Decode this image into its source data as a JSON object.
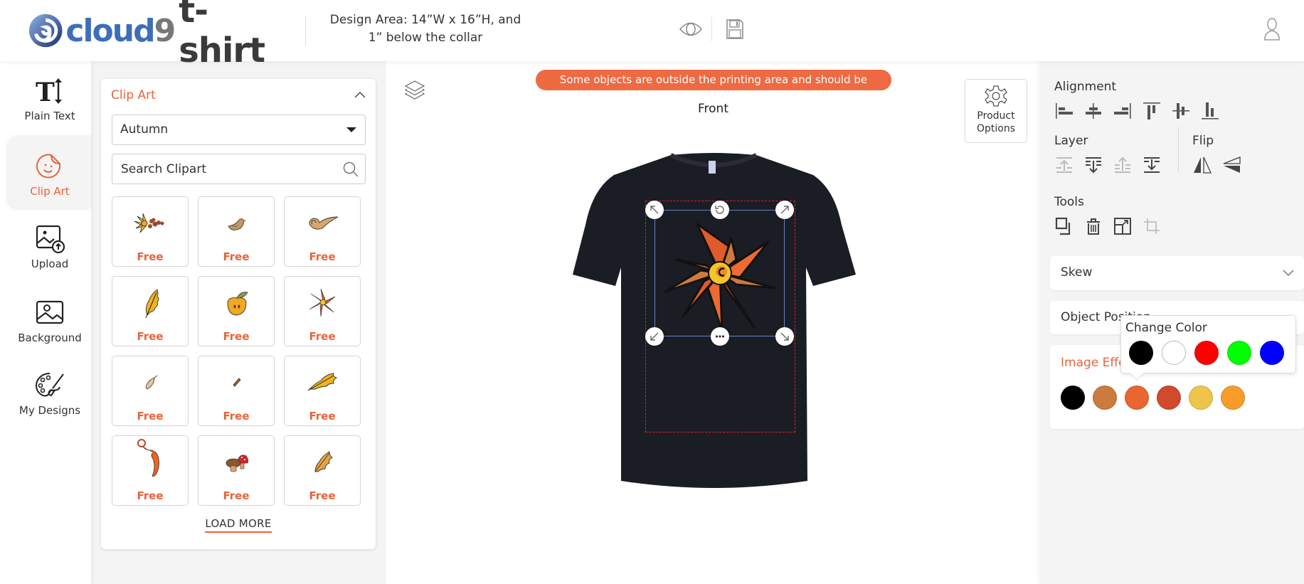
{
  "header": {
    "logo_text_part1": "cloud",
    "logo_text_part2": "9",
    "logo_text_part3": "t-shirt",
    "design_area_line1": "Design Area: 14”W x 16”H, and",
    "design_area_line2": "1” below the collar",
    "icons": [
      "eye-icon",
      "save-icon",
      "user-icon"
    ]
  },
  "left_nav": {
    "items": [
      {
        "label": "Plain Text",
        "icon": "text-icon",
        "active": false
      },
      {
        "label": "Clip Art",
        "icon": "sticker-icon",
        "active": true
      },
      {
        "label": "Upload",
        "icon": "upload-image-icon",
        "active": false
      },
      {
        "label": "Background",
        "icon": "image-icon",
        "active": false
      },
      {
        "label": "My Designs",
        "icon": "palette-icon",
        "active": false
      }
    ]
  },
  "clip_panel": {
    "title": "Clip Art",
    "category_selected": "Autumn",
    "search_placeholder": "Search Clipart",
    "tiles": [
      {
        "name": "sunflower-berries",
        "price": "Free"
      },
      {
        "name": "bird",
        "price": "Free"
      },
      {
        "name": "swirl-wind",
        "price": "Free"
      },
      {
        "name": "oak-leaf-yellow",
        "price": "Free"
      },
      {
        "name": "apple",
        "price": "Free"
      },
      {
        "name": "red-flower",
        "price": "Free"
      },
      {
        "name": "wheat",
        "price": "Free"
      },
      {
        "name": "acorn-twig",
        "price": "Free"
      },
      {
        "name": "oak-leaf-sideways",
        "price": "Free"
      },
      {
        "name": "curly-vine",
        "price": "Free"
      },
      {
        "name": "mushrooms",
        "price": "Free"
      },
      {
        "name": "oak-leaf-brown",
        "price": "Free"
      }
    ],
    "load_more": "LOAD MORE"
  },
  "canvas": {
    "warning": "Some objects are outside the printing area and should be adjusted",
    "side": "Front",
    "product_options_line1": "Product",
    "product_options_line2": "Options",
    "colors": {
      "shirt": "#1b1d24",
      "print_area_border": "#e0202e",
      "selection_border": "#6680cc",
      "warning_bg": "#ed6a43"
    }
  },
  "right_panel": {
    "alignment_title": "Alignment",
    "alignment_tools": [
      "align-left",
      "align-center-horizontal",
      "align-right",
      "align-top",
      "align-middle-vertical",
      "align-bottom"
    ],
    "layer_title": "Layer",
    "layer_tools": [
      {
        "name": "bring-forward",
        "enabled": false
      },
      {
        "name": "send-backward",
        "enabled": true
      },
      {
        "name": "bring-to-front",
        "enabled": false
      },
      {
        "name": "send-to-back",
        "enabled": true
      }
    ],
    "flip_title": "Flip",
    "flip_tools": [
      "flip-horizontal",
      "flip-vertical"
    ],
    "tools_title": "Tools",
    "tools": [
      {
        "name": "duplicate",
        "enabled": true
      },
      {
        "name": "delete",
        "enabled": true
      },
      {
        "name": "resize-to-fit",
        "enabled": true
      },
      {
        "name": "crop",
        "enabled": false
      }
    ],
    "skew_title": "Skew",
    "object_position_title": "Object Position",
    "image_effects_title": "Image Effects",
    "image_colors": [
      "#000000",
      "#cc7a3d",
      "#ea6630",
      "#d04a2b",
      "#efc44a",
      "#f79c2b"
    ],
    "change_color_popup": {
      "title": "Change Color",
      "colors": [
        "#000000",
        "#ffffff",
        "#ff0000",
        "#00ff00",
        "#0000ff"
      ]
    }
  },
  "accent_color": "#e8643a"
}
